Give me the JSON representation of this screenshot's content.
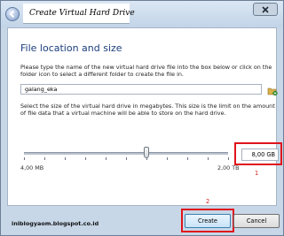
{
  "window": {
    "title": "Create Virtual Hard Drive"
  },
  "page": {
    "heading": "File location and size",
    "location_description": "Please type the name of the new virtual hard drive file into the box below or click on the folder icon to select a different folder to create the file in.",
    "size_description": "Select the size of the virtual hard drive in megabytes. This size is the limit on the amount of file data that a virtual machine will be able to store on the hard drive."
  },
  "file": {
    "value": "galang_eka"
  },
  "size": {
    "min_label": "4,00 MB",
    "max_label": "2,00 TB",
    "value": "8,00 GB",
    "slider_fraction": 0.6
  },
  "annotations": {
    "marker_1": "1",
    "marker_2": "2",
    "highlight_color": "#e0141b"
  },
  "footer": {
    "watermark": "inibIogyaom.blogspot.co.id"
  },
  "buttons": {
    "create": "Create",
    "cancel": "Cancel"
  },
  "icons": {
    "back": "back-arrow-icon",
    "close": "close-icon",
    "folder": "folder-icon"
  }
}
